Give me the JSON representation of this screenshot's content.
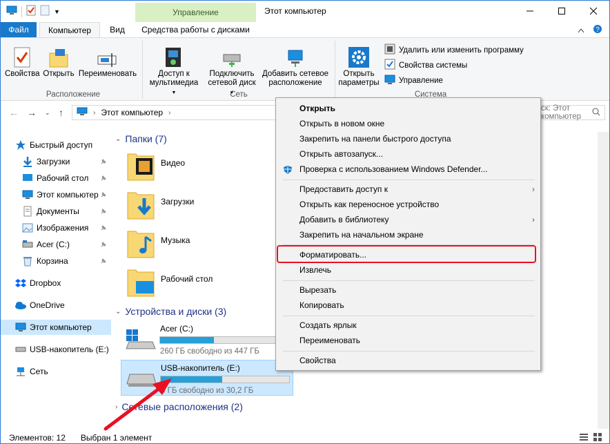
{
  "window": {
    "title": "Этот компьютер",
    "context_tab_header": "Управление"
  },
  "tabs": {
    "file": "Файл",
    "computer": "Компьютер",
    "view": "Вид",
    "disk_tools": "Средства работы с дисками"
  },
  "ribbon": {
    "properties": "Свойства",
    "open": "Открыть",
    "rename": "Переименовать",
    "group_location": "Расположение",
    "media_access_line1": "Доступ к",
    "media_access_line2": "мультимедиа",
    "map_drive_line1": "Подключить",
    "map_drive_line2": "сетевой диск",
    "add_location_line1": "Добавить сетевое",
    "add_location_line2": "расположение",
    "group_network": "Сеть",
    "open_settings_line1": "Открыть",
    "open_settings_line2": "параметры",
    "uninstall": "Удалить или изменить программу",
    "system_properties": "Свойства системы",
    "manage": "Управление",
    "group_system": "Система"
  },
  "address": {
    "path": "Этот компьютер",
    "search_placeholder": "ск: Этот компьютер"
  },
  "sidebar": {
    "items": [
      {
        "label": "Быстрый доступ"
      },
      {
        "label": "Загрузки"
      },
      {
        "label": "Рабочий стол"
      },
      {
        "label": "Этот компьютер"
      },
      {
        "label": "Документы"
      },
      {
        "label": "Изображения"
      },
      {
        "label": "Acer (C:)"
      },
      {
        "label": "Корзина"
      },
      {
        "label": "Dropbox"
      },
      {
        "label": "OneDrive"
      },
      {
        "label": "Этот компьютер"
      },
      {
        "label": "USB-накопитель (E:)"
      },
      {
        "label": "Сеть"
      }
    ]
  },
  "main": {
    "folders_header": "Папки (7)",
    "folders": [
      {
        "name": "Видео"
      },
      {
        "name": "Загрузки"
      },
      {
        "name": "Музыка"
      },
      {
        "name": "Рабочий стол"
      }
    ],
    "devices_header": "Устройства и диски (3)",
    "drives": [
      {
        "name": "Acer (C:)",
        "info": "260 ГБ свободно из 447 ГБ",
        "used_fraction": 0.42
      },
      {
        "name": "USB-накопитель (E:)",
        "info": "6 ГБ свободно из 30,2 ГБ",
        "used_fraction": 0.48
      }
    ],
    "network_header": "Сетевые расположения (2)"
  },
  "context_menu": {
    "items": [
      {
        "label": "Открыть"
      },
      {
        "label": "Открыть в новом окне"
      },
      {
        "label": "Закрепить на панели быстрого доступа"
      },
      {
        "label": "Открыть автозапуск..."
      },
      {
        "label": "Проверка с использованием Windows Defender..."
      },
      {
        "label": "Предоставить доступ к"
      },
      {
        "label": "Открыть как переносное устройство"
      },
      {
        "label": "Добавить в библиотеку"
      },
      {
        "label": "Закрепить на начальном экране"
      },
      {
        "label": "Форматировать..."
      },
      {
        "label": "Извлечь"
      },
      {
        "label": "Вырезать"
      },
      {
        "label": "Копировать"
      },
      {
        "label": "Создать ярлык"
      },
      {
        "label": "Переименовать"
      },
      {
        "label": "Свойства"
      }
    ]
  },
  "status": {
    "items_count": "Элементов: 12",
    "selected": "Выбран 1 элемент"
  },
  "colors": {
    "accent": "#1979ca",
    "highlight": "#e81123",
    "selection": "#cce8ff",
    "drive_bar": "#26a0da"
  }
}
